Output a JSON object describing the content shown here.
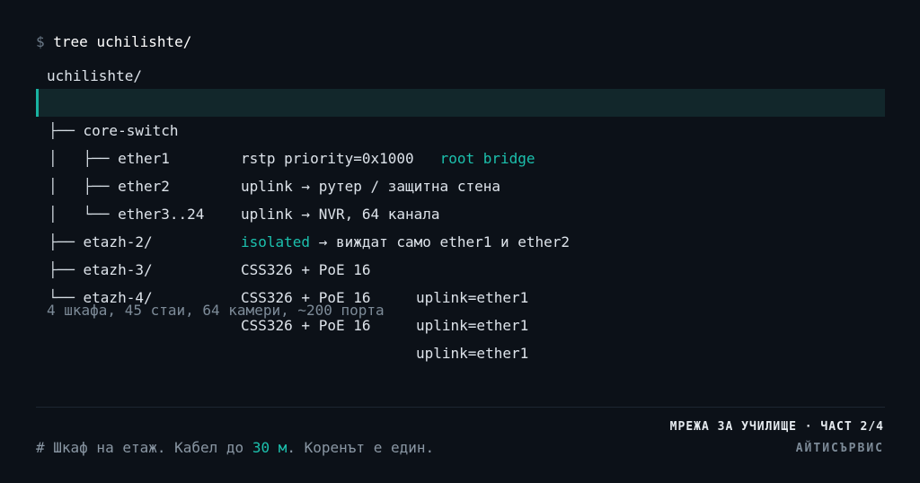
{
  "terminal": {
    "prompt_symbol": "$",
    "command": "tree uchilishte/"
  },
  "tree": {
    "root": "uchilishte/",
    "rows": [
      {
        "branch": "├── ",
        "name": "core-switch",
        "detail_main": "rstp priority=0x1000",
        "detail_accent": "root bridge",
        "highlighted": true
      },
      {
        "branch": "│   ├── ",
        "name": "ether1",
        "detail_main": "uplink → рутер / защитна стена"
      },
      {
        "branch": "│   ├── ",
        "name": "ether2",
        "detail_main": "uplink → NVR, 64 канала"
      },
      {
        "branch": "│   └── ",
        "name": "ether3..24",
        "detail_accent_lead": "isolated",
        "detail_tail": " → виждат само ether1 и ether2"
      },
      {
        "branch": "├── ",
        "name": "etazh-2/",
        "detail_main": "CSS326 + PoE 16",
        "extra": "uplink=ether1"
      },
      {
        "branch": "├── ",
        "name": "etazh-3/",
        "detail_main": "CSS326 + PoE 16",
        "extra": "uplink=ether1"
      },
      {
        "branch": "└── ",
        "name": "etazh-4/",
        "detail_main": "CSS326 + PoE 16",
        "extra": "uplink=ether1"
      }
    ]
  },
  "summary": "4 шкафа, 45 стаи, 64 камери, ~200 порта",
  "footer": {
    "comment_prefix": "# Шкаф на етаж. Кабел до ",
    "comment_highlight": "30 м",
    "comment_suffix": ". Коренът е един.",
    "series_label": "МРЕЖА ЗА УЧИЛИЩЕ · ЧАСТ 2/4",
    "brand": "АЙТИСЪРВИС"
  },
  "colors": {
    "background": "#0c1118",
    "accent": "#1cc0ad",
    "highlight_row": "#12272b",
    "muted": "#7d8b98"
  }
}
